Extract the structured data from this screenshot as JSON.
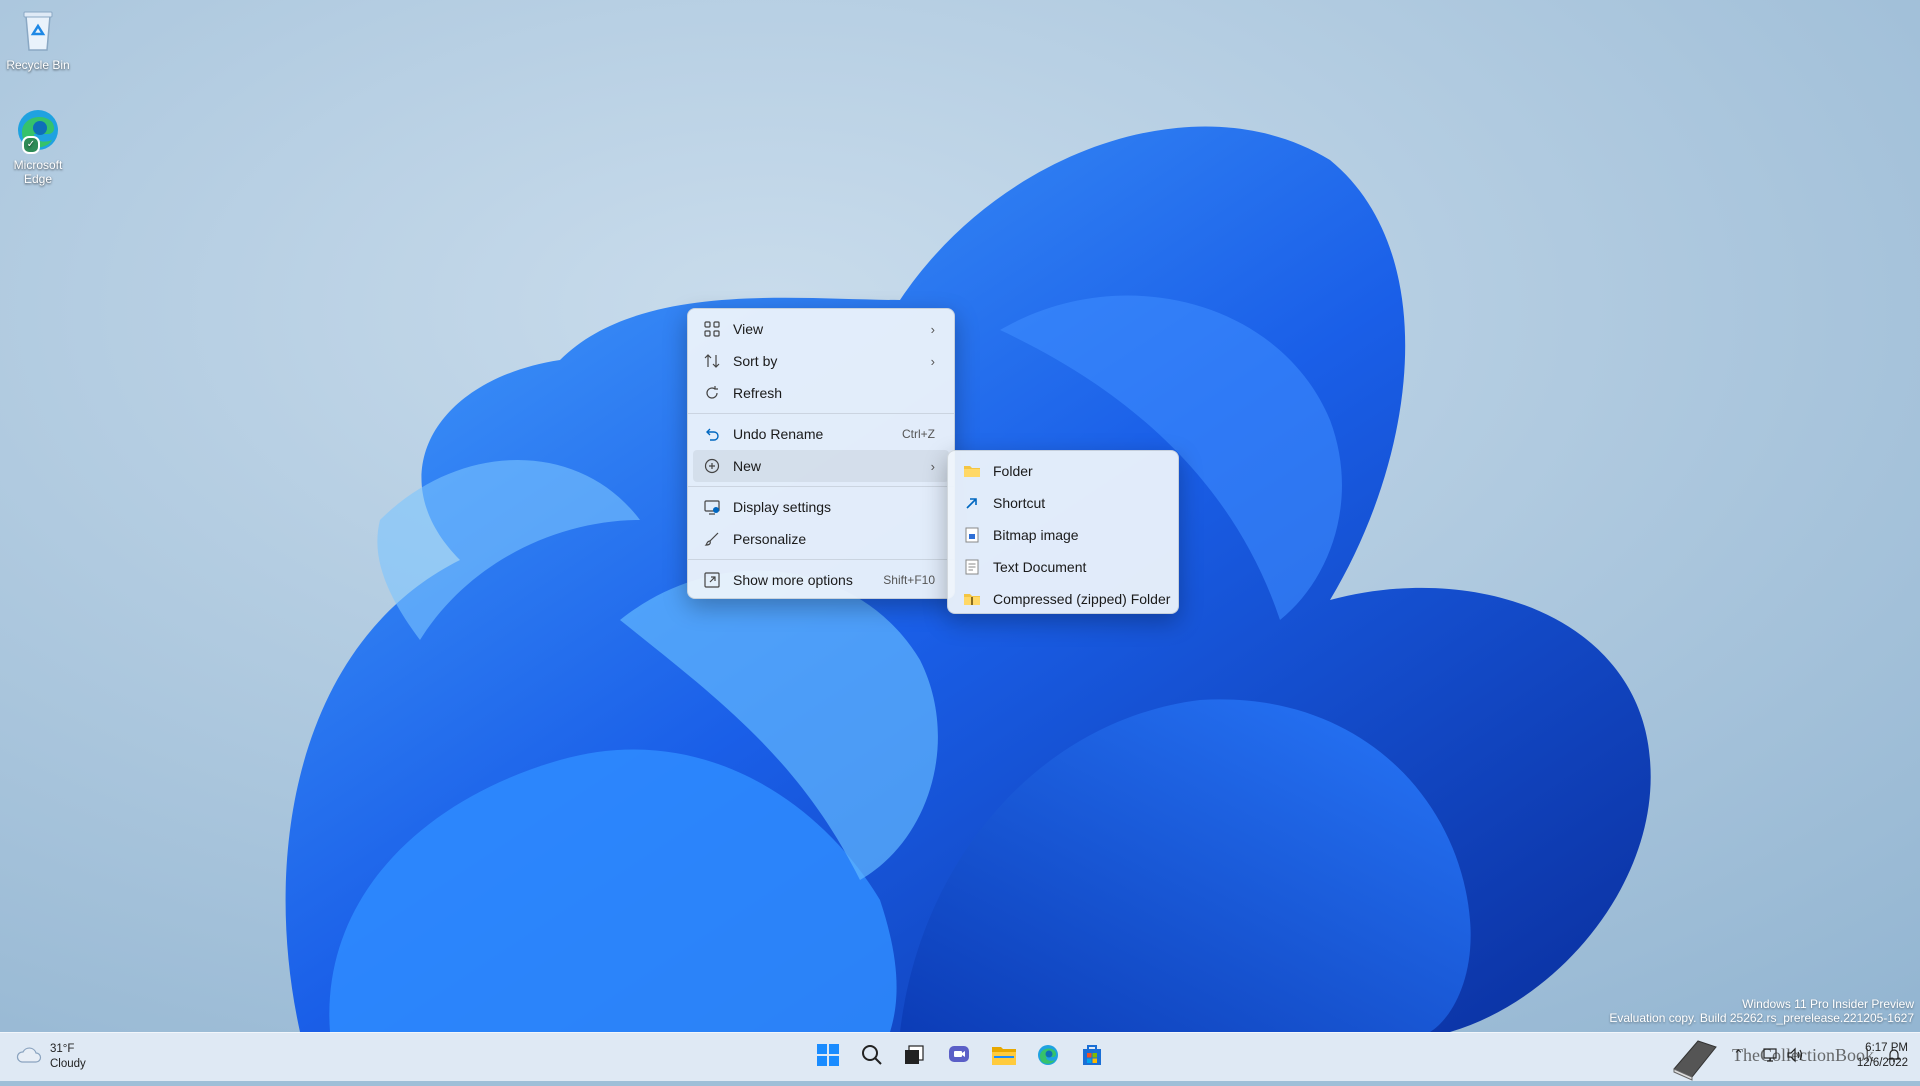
{
  "desktop": {
    "icons": [
      {
        "label": "Recycle Bin",
        "icon": "recycle-bin-icon"
      },
      {
        "label": "Microsoft Edge",
        "icon": "edge-icon"
      }
    ],
    "watermark": {
      "line1": "Windows 11 Pro Insider Preview",
      "line2": "Evaluation copy. Build 25262.rs_prerelease.221205-1627"
    }
  },
  "context_menu": {
    "items": [
      {
        "label": "View",
        "icon": "view-grid-icon",
        "submenu": true
      },
      {
        "label": "Sort by",
        "icon": "sort-icon",
        "submenu": true
      },
      {
        "label": "Refresh",
        "icon": "refresh-icon"
      },
      {
        "label": "Undo Rename",
        "icon": "undo-icon",
        "shortcut": "Ctrl+Z"
      },
      {
        "label": "New",
        "icon": "new-plus-icon",
        "submenu": true,
        "active": true
      },
      {
        "label": "Display settings",
        "icon": "display-settings-icon"
      },
      {
        "label": "Personalize",
        "icon": "personalize-brush-icon"
      },
      {
        "label": "Show more options",
        "icon": "show-more-options-icon",
        "shortcut": "Shift+F10"
      }
    ]
  },
  "new_submenu": {
    "items": [
      {
        "label": "Folder",
        "icon": "folder-icon"
      },
      {
        "label": "Shortcut",
        "icon": "shortcut-icon"
      },
      {
        "label": "Bitmap image",
        "icon": "bitmap-image-icon"
      },
      {
        "label": "Text Document",
        "icon": "text-document-icon"
      },
      {
        "label": "Compressed (zipped) Folder",
        "icon": "zip-folder-icon"
      }
    ]
  },
  "taskbar": {
    "weather": {
      "temp": "31°F",
      "condition": "Cloudy",
      "icon": "cloud-icon"
    },
    "apps": [
      "start-icon",
      "search-icon",
      "task-view-icon",
      "chat-icon",
      "file-explorer-icon",
      "edge-icon",
      "store-icon"
    ],
    "tray": {
      "time": "6:17 PM",
      "date": "12/6/2022",
      "overlay_text": "TheCollectionBook"
    }
  },
  "colors": {
    "accent": "#0067c0",
    "menu_bg": "#eef4fb",
    "wallpaper_blue": "#1a5fe8"
  }
}
